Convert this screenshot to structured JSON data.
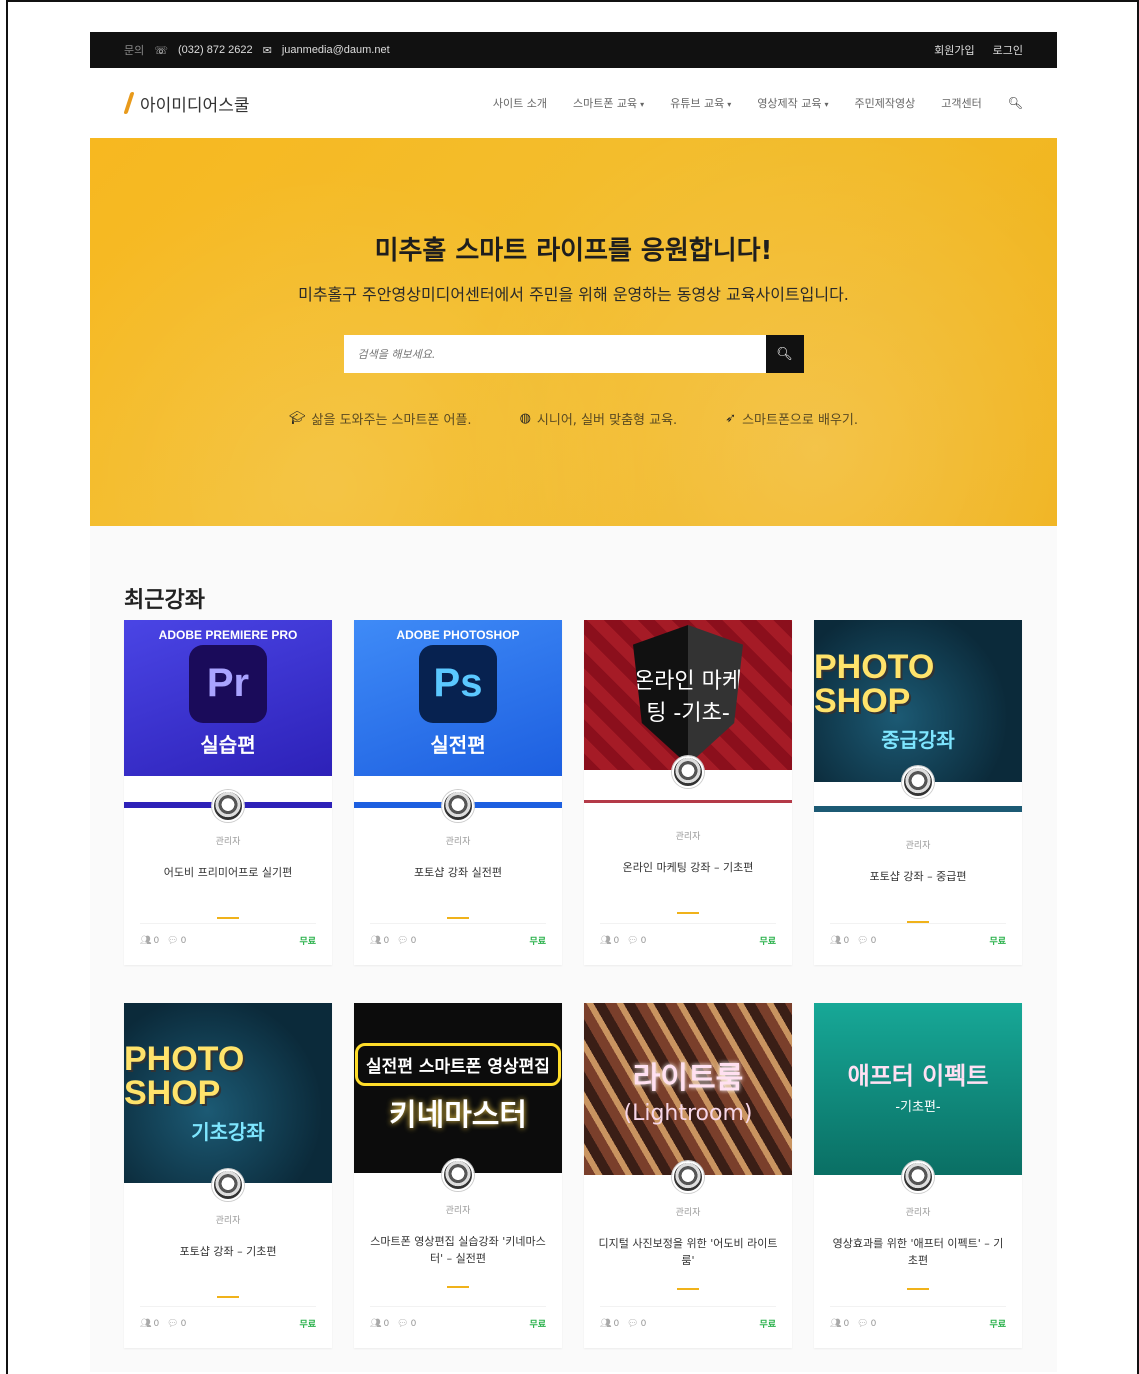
{
  "topbar": {
    "contact_label": "문의",
    "phone": "(032) 872 2622",
    "email": "juanmedia@daum.net",
    "signup": "회원가입",
    "login": "로그인"
  },
  "header": {
    "logo_text": "아이미디어스쿨",
    "nav": [
      {
        "label": "사이트 소개"
      },
      {
        "label": "스마트폰 교육"
      },
      {
        "label": "유튜브 교육"
      },
      {
        "label": "영상제작 교육"
      },
      {
        "label": "주민제작영상"
      },
      {
        "label": "고객센터"
      }
    ]
  },
  "hero": {
    "title": "미추홀 스마트 라이프를 응원합니다!",
    "subtitle": "미추홀구 주안영상미디어센터에서 주민을 위해 운영하는 동영상 교육사이트입니다.",
    "search_placeholder": "검색을 해보세요.",
    "features": [
      {
        "icon": "graduation-cap-icon",
        "label": "삶을 도와주는 스마트폰 어플."
      },
      {
        "icon": "life-ring-icon",
        "label": "시니어, 실버 맞춤형 교육."
      },
      {
        "icon": "paper-plane-icon",
        "label": "스마트폰으로 배우기."
      }
    ]
  },
  "recent": {
    "heading": "최근강좌",
    "courses": [
      {
        "thumb_caption": "ADOBE PREMIERE PRO",
        "badge": "Pr",
        "thumb_text": "실습편",
        "author": "관리자",
        "title": "어도비 프리미어프로 실기편",
        "likes": "0",
        "comments": "0",
        "price": "무료"
      },
      {
        "thumb_caption": "ADOBE PHOTOSHOP",
        "badge": "Ps",
        "thumb_text": "실전편",
        "author": "관리자",
        "title": "포토샵 강좌 실전편",
        "likes": "0",
        "comments": "0",
        "price": "무료"
      },
      {
        "thumb_caption": "",
        "badge": "",
        "thumb_text": "온라인 마케팅 -기초-",
        "author": "관리자",
        "title": "온라인 마케팅 강좌 – 기초편",
        "likes": "0",
        "comments": "0",
        "price": "무료"
      },
      {
        "thumb_caption": "PHOTO SHOP",
        "badge": "",
        "thumb_text": "중급강좌",
        "author": "관리자",
        "title": "포토샵 강좌 – 중급편",
        "likes": "0",
        "comments": "0",
        "price": "무료"
      },
      {
        "thumb_caption": "PHOTO SHOP",
        "badge": "",
        "thumb_text": "기초강좌",
        "author": "관리자",
        "title": "포토샵 강좌 – 기초편",
        "likes": "0",
        "comments": "0",
        "price": "무료"
      },
      {
        "thumb_caption": "실전편 스마트폰 영상편집",
        "badge": "",
        "thumb_text": "키네마스터",
        "author": "관리자",
        "title": "스마트폰 영상편집 실습강좌 '키네마스터' – 실전편",
        "likes": "0",
        "comments": "0",
        "price": "무료"
      },
      {
        "thumb_caption": "라이트룸",
        "badge": "",
        "thumb_text": "(Lightroom)",
        "author": "관리자",
        "title": "디지털 사진보정을 위한 '어도비 라이트룸'",
        "likes": "0",
        "comments": "0",
        "price": "무료"
      },
      {
        "thumb_caption": "애프터 이펙트",
        "badge": "",
        "thumb_text": "-기초편-",
        "author": "관리자",
        "title": "영상효과를 위한 '애프터 이펙트' – 기초편",
        "likes": "0",
        "comments": "0",
        "price": "무료"
      }
    ]
  },
  "colors": {
    "topbar": "#111111",
    "hero": "#f5b820",
    "free": "#2bb24c",
    "accent_dash": "#f0b21a"
  }
}
